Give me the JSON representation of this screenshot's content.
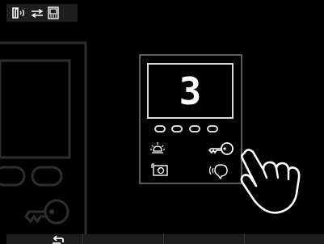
{
  "display": {
    "digit": "3"
  },
  "status_bar": {
    "icons": [
      "door-release-icon",
      "swap-arrows-icon",
      "monitor-icon"
    ]
  },
  "device": {
    "icons": [
      "light-icon",
      "key-icon",
      "camera-icon",
      "intercom-icon",
      "hand-pointer-icon"
    ]
  },
  "bottom_bar": {
    "icons": [
      "back-arrow-icon"
    ]
  },
  "colors": {
    "background": "#000000",
    "bar": "#1d1d1d",
    "outline": "#d8d8d8",
    "dim_outline": "#5c5c5c",
    "ghost": "#2e2e2e"
  }
}
